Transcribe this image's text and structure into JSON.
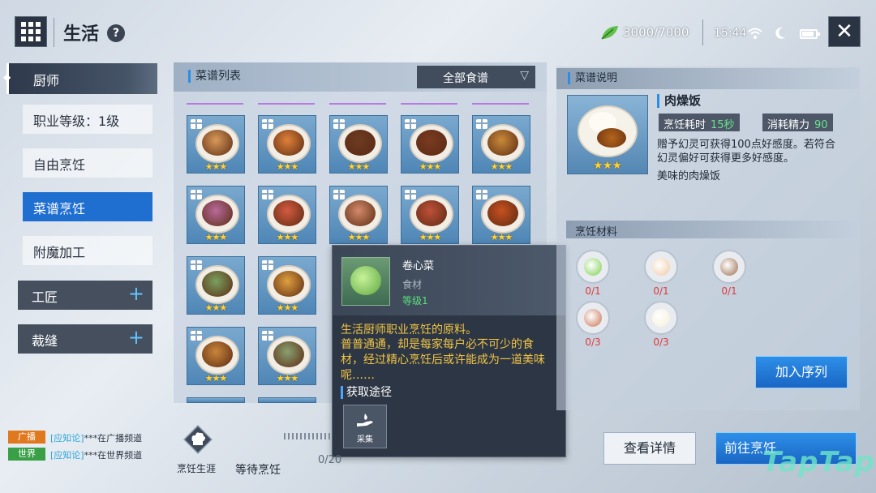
{
  "header": {
    "title": "生活",
    "help_icon": "question-icon",
    "energy": "3000/7000",
    "time": "15:44",
    "close_icon": "close-icon"
  },
  "sidebar": {
    "active_category": "厨师",
    "items": [
      {
        "label": "职业等级：1级",
        "selected": false
      },
      {
        "label": "自由烹饪",
        "selected": false
      },
      {
        "label": "菜谱烹饪",
        "selected": true
      },
      {
        "label": "附魔加工",
        "selected": false
      }
    ],
    "groups": [
      {
        "label": "工匠",
        "icon": "plus-icon"
      },
      {
        "label": "裁缝",
        "icon": "plus-icon"
      }
    ]
  },
  "recipe_list": {
    "title": "菜谱列表",
    "filter_value": "全部食谱",
    "stars": "★★★",
    "food_colors": [
      "#d99a5a",
      "#e0813a",
      "#6e3a22",
      "#7a3a22",
      "#c98a3a",
      "#b86a9a",
      "#d45a40",
      "#d48a6a",
      "#c0503a",
      "#c85020",
      "#7aa060",
      "#e0a040",
      "#c9853a",
      "#8aa070"
    ]
  },
  "tooltip": {
    "name": "卷心菜",
    "type": "食材",
    "level": "等级1",
    "desc_main": "生活厨师职业烹饪的原料。",
    "desc_detail": "普普通通，却是每家每户必不可少的食材，经过精心烹饪后或许能成为一道美味呢……",
    "source_title": "获取途径",
    "source_label": "采集"
  },
  "recipe_detail": {
    "title": "菜谱说明",
    "dish_name": "肉燥饭",
    "stars": "★★★",
    "cook_time_label": "烹饪耗时",
    "cook_time_value": "15秒",
    "energy_cost_label": "消耗精力",
    "energy_cost_value": "90",
    "description": "赠予幻灵可获得100点好感度。若符合幻灵偏好可获得更多好感度。",
    "flavor": "美味的肉燥饭",
    "materials_title": "烹饪材料",
    "materials": [
      {
        "name": "cabbage",
        "count": "0/1",
        "color": "#7ccf4e"
      },
      {
        "name": "egg",
        "count": "0/1",
        "color": "#f0c8a0"
      },
      {
        "name": "mushroom",
        "count": "0/1",
        "color": "#9a6a4a"
      },
      {
        "name": "meat",
        "count": "0/3",
        "color": "#c87050"
      },
      {
        "name": "tofu",
        "count": "0/3",
        "color": "#f4eed8"
      }
    ],
    "add_queue_label": "加入序列"
  },
  "chat": [
    {
      "tag": "广播",
      "tag_color": "#e0781e",
      "name": "[应知论]",
      "text": "***在广播频道"
    },
    {
      "tag": "世界",
      "tag_color": "#3aa048",
      "name": "[应知论]",
      "text": "***在世界频道"
    }
  ],
  "footer": {
    "career_label": "烹饪生涯",
    "waiting_label": "等待烹饪",
    "queue_count": "0/20",
    "detail_label": "查看详情",
    "go_label": "前往烹饪",
    "watermark": "TapTap"
  }
}
